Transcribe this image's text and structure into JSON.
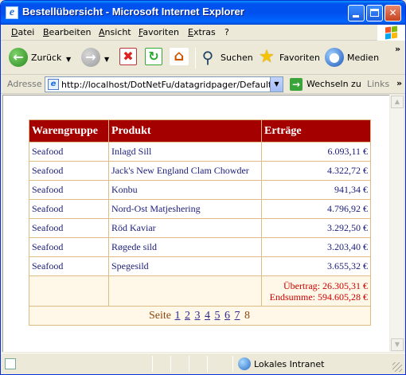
{
  "window": {
    "title": "Bestellübersicht - Microsoft Internet Explorer"
  },
  "menu": [
    "Datei",
    "Bearbeiten",
    "Ansicht",
    "Favoriten",
    "Extras",
    "?"
  ],
  "toolbar": {
    "back_label": "Zurück",
    "search_label": "Suchen",
    "favorites_label": "Favoriten",
    "media_label": "Medien",
    "icons": [
      "back-arrow-icon",
      "forward-arrow-icon",
      "stop-icon",
      "refresh-icon",
      "home-icon",
      "search-icon",
      "favorites-star-icon",
      "media-icon"
    ]
  },
  "address": {
    "label": "Adresse",
    "url": "http://localhost/DotNetFu/datagridpager/Default.aspx",
    "go_label": "Wechseln zu",
    "links_label": "Links"
  },
  "grid": {
    "columns": [
      "Warengruppe",
      "Produkt",
      "Erträge"
    ],
    "rows": [
      [
        "Seafood",
        "Inlagd Sill",
        "6.093,11 €"
      ],
      [
        "Seafood",
        "Jack's New England Clam Chowder",
        "4.322,72 €"
      ],
      [
        "Seafood",
        "Konbu",
        "941,34 €"
      ],
      [
        "Seafood",
        "Nord-Ost Matjeshering",
        "4.796,92 €"
      ],
      [
        "Seafood",
        "Röd Kaviar",
        "3.292,50 €"
      ],
      [
        "Seafood",
        "Røgede sild",
        "3.203,40 €"
      ],
      [
        "Seafood",
        "Spegesild",
        "3.655,32 €"
      ]
    ],
    "footer": {
      "carry_over": "Übertrag: 26.305,31 €",
      "total": "Endsumme: 594.605,28 €"
    },
    "pager": {
      "label": "Seite",
      "pages": [
        "1",
        "2",
        "3",
        "4",
        "5",
        "6",
        "7",
        "8"
      ],
      "current": "8"
    }
  },
  "status": {
    "zone": "Lokales Intranet"
  },
  "colors": {
    "header_bg": "#a50000",
    "row_text": "#1b1c7a",
    "footer_text": "#cc0000",
    "footer_bg": "#fff7e7"
  }
}
